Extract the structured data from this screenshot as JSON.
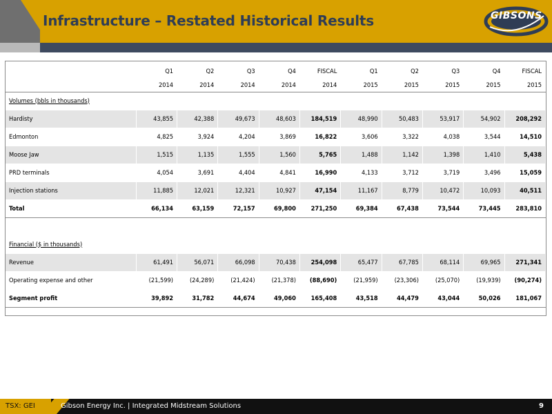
{
  "header": {
    "title": "Infrastructure – Restated Historical Results",
    "logo_text": "GIBSONS"
  },
  "colors": {
    "accent": "#d8a100",
    "dark_stripe": "#3e4a5f",
    "title": "#2f3d55",
    "shade": "#e4e4e4"
  },
  "table": {
    "columns": [
      {
        "period": "Q1",
        "year": "2014"
      },
      {
        "period": "Q2",
        "year": "2014"
      },
      {
        "period": "Q3",
        "year": "2014"
      },
      {
        "period": "Q4",
        "year": "2014"
      },
      {
        "period": "FISCAL",
        "year": "2014"
      },
      {
        "period": "Q1",
        "year": "2015"
      },
      {
        "period": "Q2",
        "year": "2015"
      },
      {
        "period": "Q3",
        "year": "2015"
      },
      {
        "period": "Q4",
        "year": "2015"
      },
      {
        "period": "FISCAL",
        "year": "2015"
      }
    ],
    "volumes_section": "Volumes (bbls in thousands)",
    "volumes": [
      {
        "label": "Hardisty",
        "values": [
          "43,855",
          "42,388",
          "49,673",
          "48,603",
          "184,519",
          "48,990",
          "50,483",
          "53,917",
          "54,902",
          "208,292"
        ]
      },
      {
        "label": "Edmonton",
        "values": [
          "4,825",
          "3,924",
          "4,204",
          "3,869",
          "16,822",
          "3,606",
          "3,322",
          "4,038",
          "3,544",
          "14,510"
        ]
      },
      {
        "label": "Moose Jaw",
        "values": [
          "1,515",
          "1,135",
          "1,555",
          "1,560",
          "5,765",
          "1,488",
          "1,142",
          "1,398",
          "1,410",
          "5,438"
        ]
      },
      {
        "label": "PRD terminals",
        "values": [
          "4,054",
          "3,691",
          "4,404",
          "4,841",
          "16,990",
          "4,133",
          "3,712",
          "3,719",
          "3,496",
          "15,059"
        ]
      },
      {
        "label": "Injection stations",
        "values": [
          "11,885",
          "12,021",
          "12,321",
          "10,927",
          "47,154",
          "11,167",
          "8,779",
          "10,472",
          "10,093",
          "40,511"
        ]
      }
    ],
    "volumes_total": {
      "label": "Total",
      "values": [
        "66,134",
        "63,159",
        "72,157",
        "69,800",
        "271,250",
        "69,384",
        "67,438",
        "73,544",
        "73,445",
        "283,810"
      ]
    },
    "financial_section": "Financial ($ in thousands)",
    "financial": [
      {
        "label": "Revenue",
        "values": [
          "61,491",
          "56,071",
          "66,098",
          "70,438",
          "254,098",
          "65,477",
          "67,785",
          "68,114",
          "69,965",
          "271,341"
        ]
      },
      {
        "label": "Operating expense and other",
        "values": [
          "(21,599)",
          "(24,289)",
          "(21,424)",
          "(21,378)",
          "(88,690)",
          "(21,959)",
          "(23,306)",
          "(25,070)",
          "(19,939)",
          "(90,274)"
        ]
      }
    ],
    "segment_profit": {
      "label": "Segment profit",
      "values": [
        "39,892",
        "31,782",
        "44,674",
        "49,060",
        "165,408",
        "43,518",
        "44,479",
        "43,044",
        "50,026",
        "181,067"
      ]
    }
  },
  "footer": {
    "ticker": "TSX: GEI",
    "text": "Gibson Energy Inc.  |  Integrated Midstream Solutions",
    "page": "9"
  }
}
